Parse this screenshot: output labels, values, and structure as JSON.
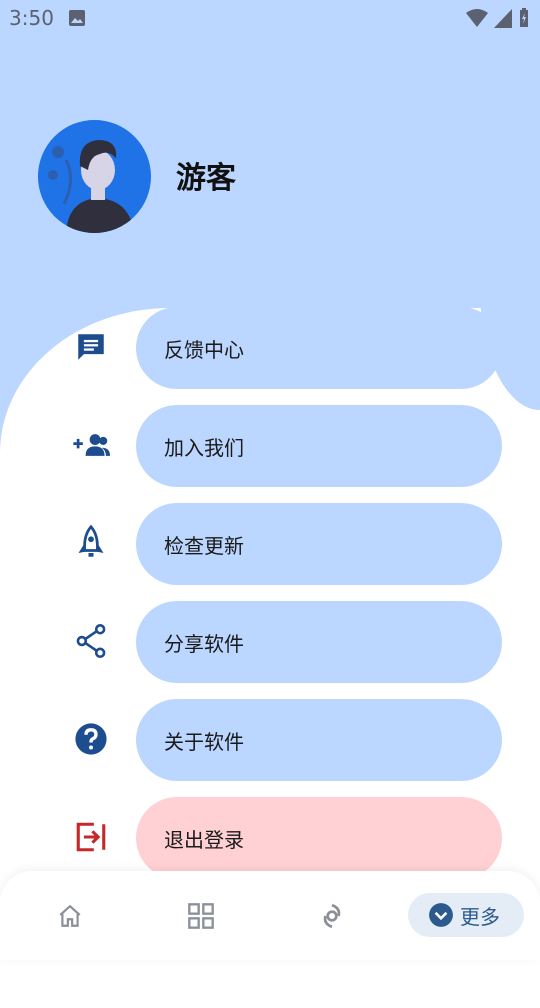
{
  "status_bar": {
    "time": "3:50"
  },
  "profile": {
    "name": "游客"
  },
  "menu": [
    {
      "label": "反馈中心",
      "icon": "feedback-icon"
    },
    {
      "label": "加入我们",
      "icon": "group-add-icon"
    },
    {
      "label": "检查更新",
      "icon": "rocket-icon"
    },
    {
      "label": "分享软件",
      "icon": "share-icon"
    },
    {
      "label": "关于软件",
      "icon": "help-icon"
    },
    {
      "label": "退出登录",
      "icon": "logout-icon"
    }
  ],
  "bottom_nav": {
    "items": [
      {
        "icon": "home-icon"
      },
      {
        "icon": "grid-icon"
      },
      {
        "icon": "spinner-icon"
      }
    ],
    "more_label": "更多"
  },
  "colors": {
    "background": "#bcd7ff",
    "menu_pill": "#bcd7ff",
    "logout_pill": "#ffd0d4",
    "icon_blue": "#1e4d8f",
    "icon_red": "#c62828"
  }
}
